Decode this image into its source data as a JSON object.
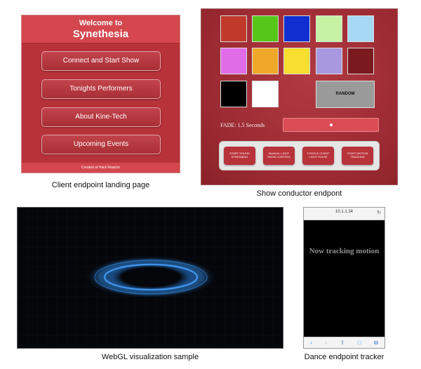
{
  "client_landing": {
    "welcome": "Welcome to",
    "app_name": "Synethesia",
    "buttons": [
      "Connect and Start Show",
      "Tonights Performers",
      "About Kine-Tech",
      "Upcoming Events"
    ],
    "footer": "Created at Hack Reactor",
    "caption": "Client endpoint landing page",
    "colors": {
      "background": "#b8323a",
      "header": "#d4474e"
    }
  },
  "conductor": {
    "swatches": [
      "#c0392b",
      "#56c71a",
      "#0f2fd0",
      "#c5f2a4",
      "#a7d8f5",
      "#e16ce8",
      "#f0a82a",
      "#f7de2f",
      "#a898e0",
      "#7a1a1e",
      "#000000",
      "#ffffff"
    ],
    "random_label": "RANDOM",
    "fade_label": "FADE: 1.5 Seconds",
    "fade_value": 1.5,
    "action_buttons": [
      "START SOUND STREAMING",
      "MANUAL LIGHT SHOW CONTROL",
      "TOGGLE CLIENT LIGHT PULSE",
      "START MOTION TRACKING"
    ],
    "caption": "Show conductor endpont"
  },
  "webgl": {
    "caption": "WebGL visualization sample",
    "colors": {
      "background": "#05060a",
      "particles": "#3a8fe0"
    }
  },
  "phone": {
    "url": "10.1.1.34",
    "message": "Now tracking motion",
    "caption": "Dance endpoint tracker",
    "icons": [
      "back-icon",
      "forward-icon",
      "share-icon",
      "bookmarks-icon",
      "tabs-icon"
    ]
  }
}
